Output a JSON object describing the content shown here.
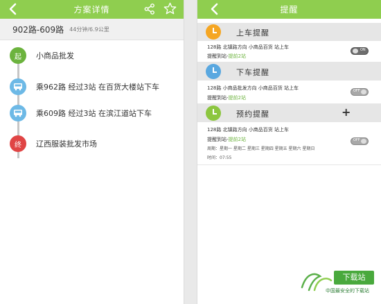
{
  "left": {
    "title": "方案详情",
    "route_name": "902路-609路",
    "route_meta": "44分钟/6.9公里",
    "steps": [
      {
        "badge": "起",
        "text": "小商品批发"
      },
      {
        "badge": "",
        "text": "乘962路 经过3站  在百货大楼站下车"
      },
      {
        "badge": "",
        "text": "乘609路 经过3站  在滨江道站下车"
      },
      {
        "badge": "终",
        "text": "辽西服装批发市场"
      }
    ],
    "icons": {
      "back": "back-arrow-icon",
      "share": "share-icon",
      "star": "star-icon"
    },
    "colors": {
      "topbar": "#8fce4f",
      "start": "#6cb33e",
      "bus": "#6db9e6",
      "end": "#e04545"
    }
  },
  "right": {
    "title": "提醒",
    "sections": [
      {
        "title": "上车提醒",
        "line1": "128路    北镇路方向    小商品百货 站上车",
        "line2_prefix": "提醒到站-",
        "line2_highlight": "提前2站",
        "toggle": "ON"
      },
      {
        "title": "下车提醒",
        "line1": "128路    小商品批发方向    小商品百货 站上车",
        "line2_prefix": "提醒到站-",
        "line2_highlight": "提前2站",
        "toggle": "OFF"
      },
      {
        "title": "预约提醒",
        "plus": "+",
        "line1": "128路    北镇路方向    小商品百货 站上车",
        "line2_prefix": "提醒到站-",
        "line2_highlight": "提前2站",
        "weekdays": "周期：星期一  星期二  星期三  星期四  星期五  星期六  星期日",
        "time": "时间：07:55",
        "toggle": "OFF"
      }
    ]
  },
  "watermark": {
    "brand": "下载站",
    "tagline": "中国最安全的下载站"
  }
}
